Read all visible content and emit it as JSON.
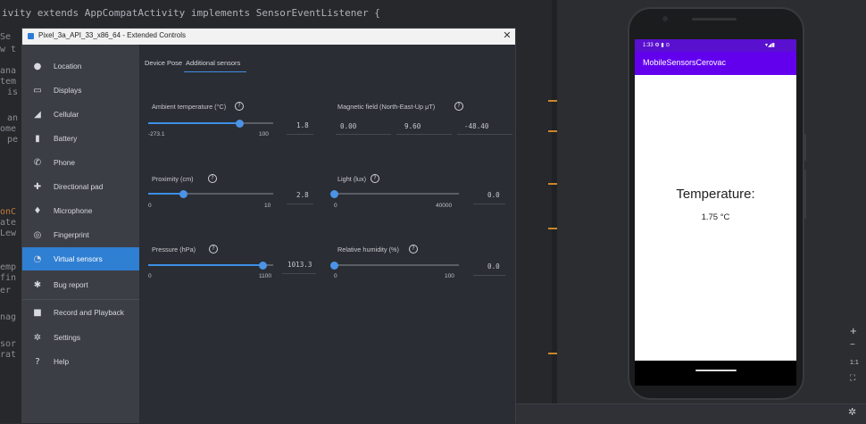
{
  "ide": {
    "top_code": "ivity extends AppCompatActivity implements SensorEventListener {",
    "gutter_fragments": [
      "Se",
      "w t",
      "ana",
      "tem",
      "is",
      "an",
      "ome",
      "pe",
      "onC",
      "ate",
      "Lew",
      "emp",
      "fin",
      "er",
      "nag",
      "sor",
      "rat"
    ]
  },
  "dialog": {
    "title": "Pixel_3a_API_33_x86_64 - Extended Controls",
    "close_glyph": "✕",
    "nav": [
      {
        "label": "Location",
        "icon": "location-pin-icon",
        "glyph": "●"
      },
      {
        "label": "Displays",
        "icon": "display-icon",
        "glyph": "▭"
      },
      {
        "label": "Cellular",
        "icon": "cellular-signal-icon",
        "glyph": "◢"
      },
      {
        "label": "Battery",
        "icon": "battery-icon",
        "glyph": "▮"
      },
      {
        "label": "Phone",
        "icon": "phone-icon",
        "glyph": "✆"
      },
      {
        "label": "Directional pad",
        "icon": "dpad-icon",
        "glyph": "✚"
      },
      {
        "label": "Microphone",
        "icon": "microphone-icon",
        "glyph": "♦"
      },
      {
        "label": "Fingerprint",
        "icon": "fingerprint-icon",
        "glyph": "◎"
      },
      {
        "label": "Virtual sensors",
        "icon": "virtual-sensors-icon",
        "glyph": "◔"
      },
      {
        "label": "Bug report",
        "icon": "bug-icon",
        "glyph": "✱"
      },
      {
        "label": "Record and Playback",
        "icon": "record-icon",
        "glyph": "■"
      },
      {
        "label": "Settings",
        "icon": "gear-icon",
        "glyph": "✲"
      },
      {
        "label": "Help",
        "icon": "help-icon",
        "glyph": "?"
      }
    ],
    "tabs": [
      {
        "label": "Device Pose"
      },
      {
        "label": "Additional sensors"
      }
    ],
    "sensors": {
      "ambient": {
        "label": "Ambient temperature (°C)",
        "min": "-273.1",
        "max": "100",
        "value": "1.8",
        "fraction": 0.732
      },
      "magnetic": {
        "label": "Magnetic field (North-East-Up μT)",
        "x": "0.00",
        "y": "9.60",
        "z": "-48.40"
      },
      "proximity": {
        "label": "Proximity (cm)",
        "min": "0",
        "max": "10",
        "value": "2.8",
        "fraction": 0.28
      },
      "light": {
        "label": "Light (lux)",
        "min": "0",
        "max": "40000",
        "value": "0.0",
        "fraction": 0.0
      },
      "pressure": {
        "label": "Pressure (hPa)",
        "min": "0",
        "max": "1100",
        "value": "1013.3",
        "fraction": 0.921
      },
      "humidity": {
        "label": "Relative humidity (%)",
        "min": "0",
        "max": "100",
        "value": "0.0",
        "fraction": 0.0
      }
    },
    "help_glyph": "?"
  },
  "phone": {
    "status_time": "1:33 ⚙ ▮ ⊙",
    "status_right": "▾◢▮",
    "app_title": "MobileSensorsCerovac",
    "temp_label": "Temperature:",
    "temp_value": "1.75 °C"
  },
  "toolbar": {
    "zoom_in": "+",
    "zoom_out": "−",
    "ratio": "1:1",
    "fit": "⛶",
    "settings": "✲"
  },
  "colors": {
    "accent": "#2f7fd3",
    "app_bar": "#6200ee",
    "slider": "#3d8fe6"
  }
}
